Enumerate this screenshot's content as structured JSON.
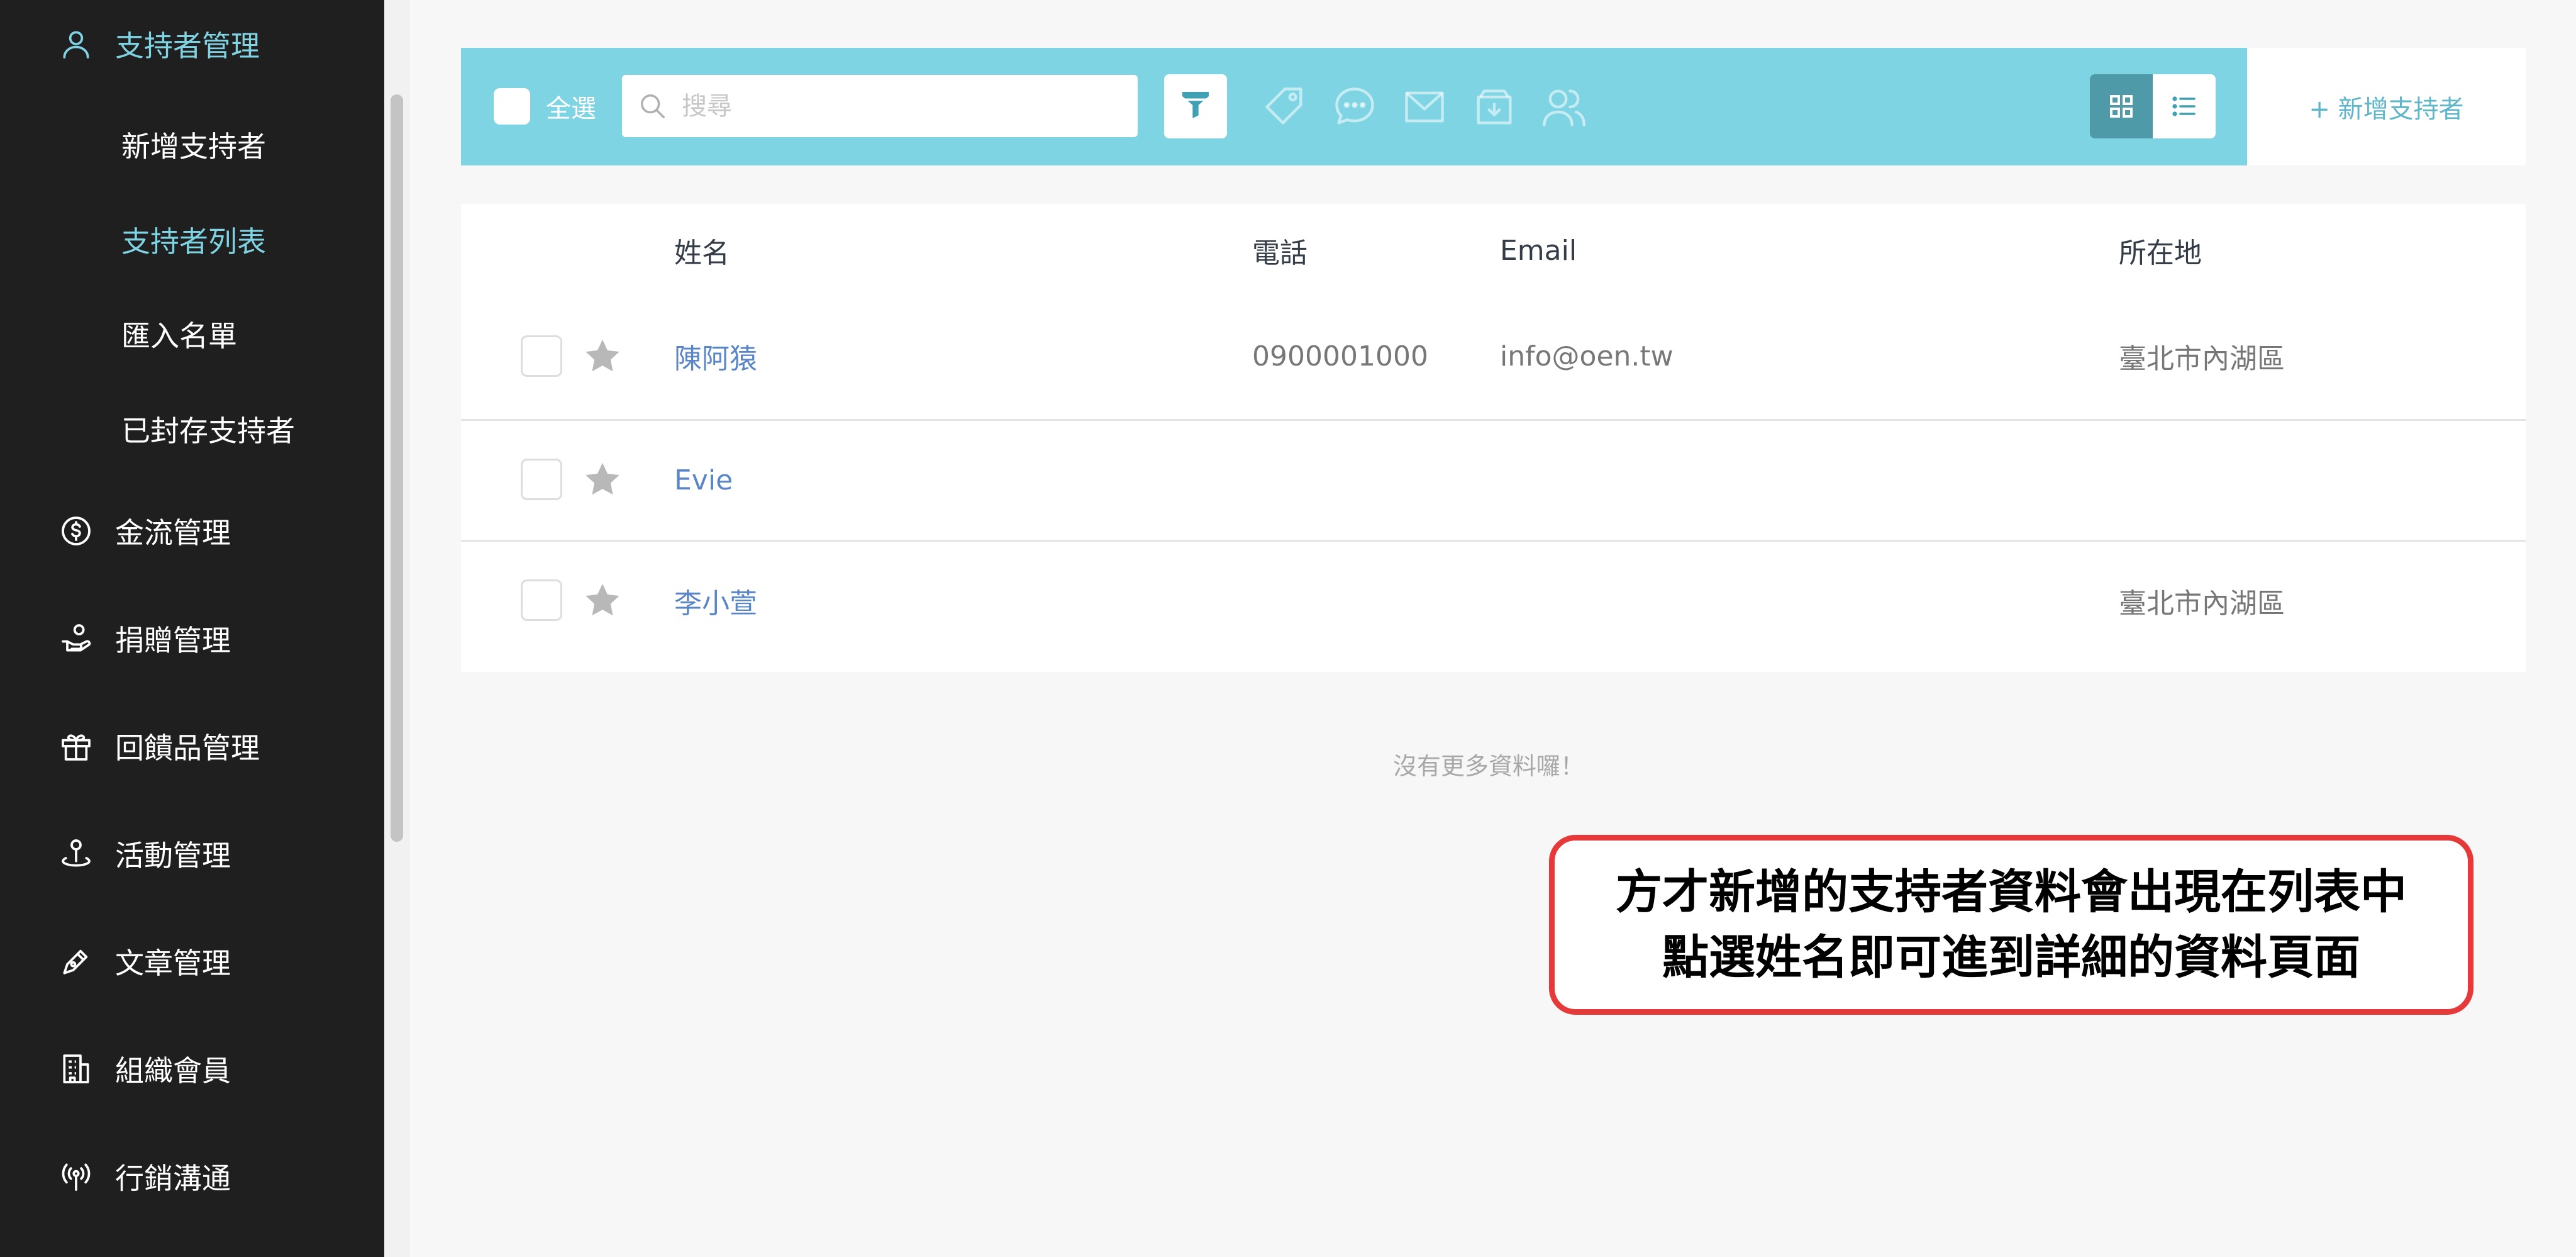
{
  "sidebar": {
    "section_title": "支持者管理",
    "sub_items": [
      {
        "label": "新增支持者",
        "active": false
      },
      {
        "label": "支持者列表",
        "active": true
      },
      {
        "label": "匯入名單",
        "active": false
      },
      {
        "label": "已封存支持者",
        "active": false
      }
    ],
    "items": [
      {
        "label": "金流管理",
        "icon": "dollar-circle-icon"
      },
      {
        "label": "捐贈管理",
        "icon": "donate-hand-icon"
      },
      {
        "label": "回饋品管理",
        "icon": "gift-icon"
      },
      {
        "label": "活動管理",
        "icon": "location-pin-icon"
      },
      {
        "label": "文章管理",
        "icon": "pen-icon"
      },
      {
        "label": "組織會員",
        "icon": "building-icon"
      },
      {
        "label": "行銷溝通",
        "icon": "broadcast-icon"
      }
    ]
  },
  "toolbar": {
    "select_all_label": "全選",
    "search_placeholder": "搜尋",
    "icons": [
      "filter-icon",
      "tag-icon",
      "chat-icon",
      "mail-icon",
      "archive-icon",
      "users-icon"
    ],
    "view_modes": [
      "grid-view-icon",
      "list-view-icon"
    ],
    "add_label": "+ 新增支持者"
  },
  "table": {
    "columns": [
      "姓名",
      "電話",
      "Email",
      "所在地"
    ],
    "rows": [
      {
        "name": "陳阿猿",
        "phone": "0900001000",
        "email": "info@oen.tw",
        "location": "臺北市內湖區"
      },
      {
        "name": "Evie",
        "phone": "",
        "email": "",
        "location": ""
      },
      {
        "name": "李小萱",
        "phone": "",
        "email": "",
        "location": "臺北市內湖區"
      }
    ]
  },
  "no_more_text": "沒有更多資料囉！",
  "callout": {
    "line1": "方才新增的支持者資料會出現在列表中",
    "line2": "點選姓名即可進到詳細的資料頁面"
  },
  "colors": {
    "accent": "#7fd4e3",
    "sidebar_bg": "#1f1f1f",
    "link": "#5a86c8",
    "callout_border": "#e63a3a"
  }
}
